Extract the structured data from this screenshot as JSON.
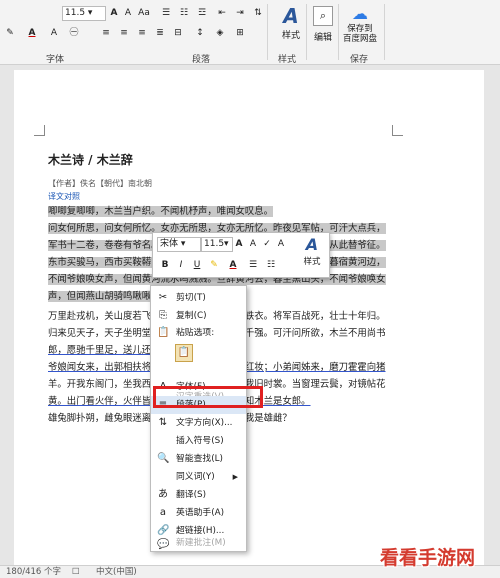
{
  "ribbon": {
    "font_size": "11.5",
    "font_group_label": "字体",
    "paragraph_group_label": "段落",
    "styles_group_label": "样式",
    "styles_label": "样式",
    "edit_label": "编辑",
    "save_label_1": "保存到",
    "save_label_2": "百度网盘",
    "save_group_label": "保存"
  },
  "document": {
    "title": "木兰诗 / 木兰辞",
    "meta": "【作者】佚名【朝代】南北朝",
    "translate_link": "译文对照",
    "lines": [
      "唧唧复唧唧，木兰当户织。不闻机杼声，唯闻女叹息。",
      "问女何所思，问女何所忆。女亦无所思，女亦无所忆。昨夜见军帖，可汗大点兵，",
      "军书十二卷，卷卷有爷名。阿爷无大儿，木兰无长兄，愿为市鞍马，从此替爷征。",
      "东市买骏马，西市买鞍鞯，南市买辔头，北市买长鞭。旦辞爷娘去，暮宿黄河边，",
      "不闻爷娘唤女声，但闻黄河流水鸣溅溅。旦辞黄河去，暮至黑山头，不闻爷娘唤女",
      "声，但闻燕山胡骑鸣啾啾。",
      "万里赴戎机，关山度若飞。朔气传金柝，寒光照铁衣。将军百战死，壮士十年归。",
      "归来见天子，天子坐明堂。策勋十二转，赏赐百千强。可汗问所欲，木兰不用尚书",
      "郎，愿驰千里足，送儿还故乡。",
      "爷娘闻女来，出郭相扶将；阿姊闻妹来，当户理红妆；小弟闻姊来，磨刀霍霍向猪",
      "羊。开我东阁门，坐我西阁床，脱我战时袍，著我旧时裳。当窗理云鬓，对镜帖花",
      "黄。出门看火伴，火伴皆惊忙：同行十二年，不知木兰是女郎。",
      "雄兔脚扑朔，雌兔眼迷离；双兔傍地走，安能辨我是雄雌？"
    ]
  },
  "mini_toolbar": {
    "font_name": "宋体",
    "font_size": "11.5",
    "styles_label": "样式"
  },
  "context_menu": {
    "items": [
      {
        "label": "剪切(T)",
        "icon": "scissors-icon",
        "glyph": "✂",
        "disabled": false
      },
      {
        "label": "复制(C)",
        "icon": "copy-icon",
        "glyph": "⎘",
        "disabled": false
      },
      {
        "label": "粘贴选项:",
        "icon": "paste-icon",
        "glyph": "📋",
        "disabled": false
      },
      {
        "label": "汉字重选(V)",
        "icon": "",
        "glyph": "",
        "disabled": true
      },
      {
        "label": "字体(F)...",
        "icon": "font-icon",
        "glyph": "A",
        "disabled": false
      },
      {
        "label": "段落(P)...",
        "icon": "paragraph-icon",
        "glyph": "≡",
        "disabled": false
      },
      {
        "label": "文字方向(X)...",
        "icon": "text-direction-icon",
        "glyph": "⇅",
        "disabled": false
      },
      {
        "label": "插入符号(S)",
        "icon": "",
        "glyph": "",
        "disabled": false
      },
      {
        "label": "智能查找(L)",
        "icon": "smart-lookup-icon",
        "glyph": "🔍",
        "disabled": false
      },
      {
        "label": "同义词(Y)",
        "icon": "",
        "glyph": "",
        "disabled": false
      },
      {
        "label": "翻译(S)",
        "icon": "translate-icon",
        "glyph": "あ",
        "disabled": false
      },
      {
        "label": "英语助手(A)",
        "icon": "english-assistant-icon",
        "glyph": "a",
        "disabled": false
      },
      {
        "label": "超链接(H)...",
        "icon": "hyperlink-icon",
        "glyph": "🔗",
        "disabled": false
      },
      {
        "label": "新建批注(M)",
        "icon": "new-comment-icon",
        "glyph": "💬",
        "disabled": true
      }
    ]
  },
  "status_bar": {
    "word_count": "180/416 个字",
    "language": "中文(中国)"
  },
  "watermark": {
    "text": "看看手游网"
  }
}
